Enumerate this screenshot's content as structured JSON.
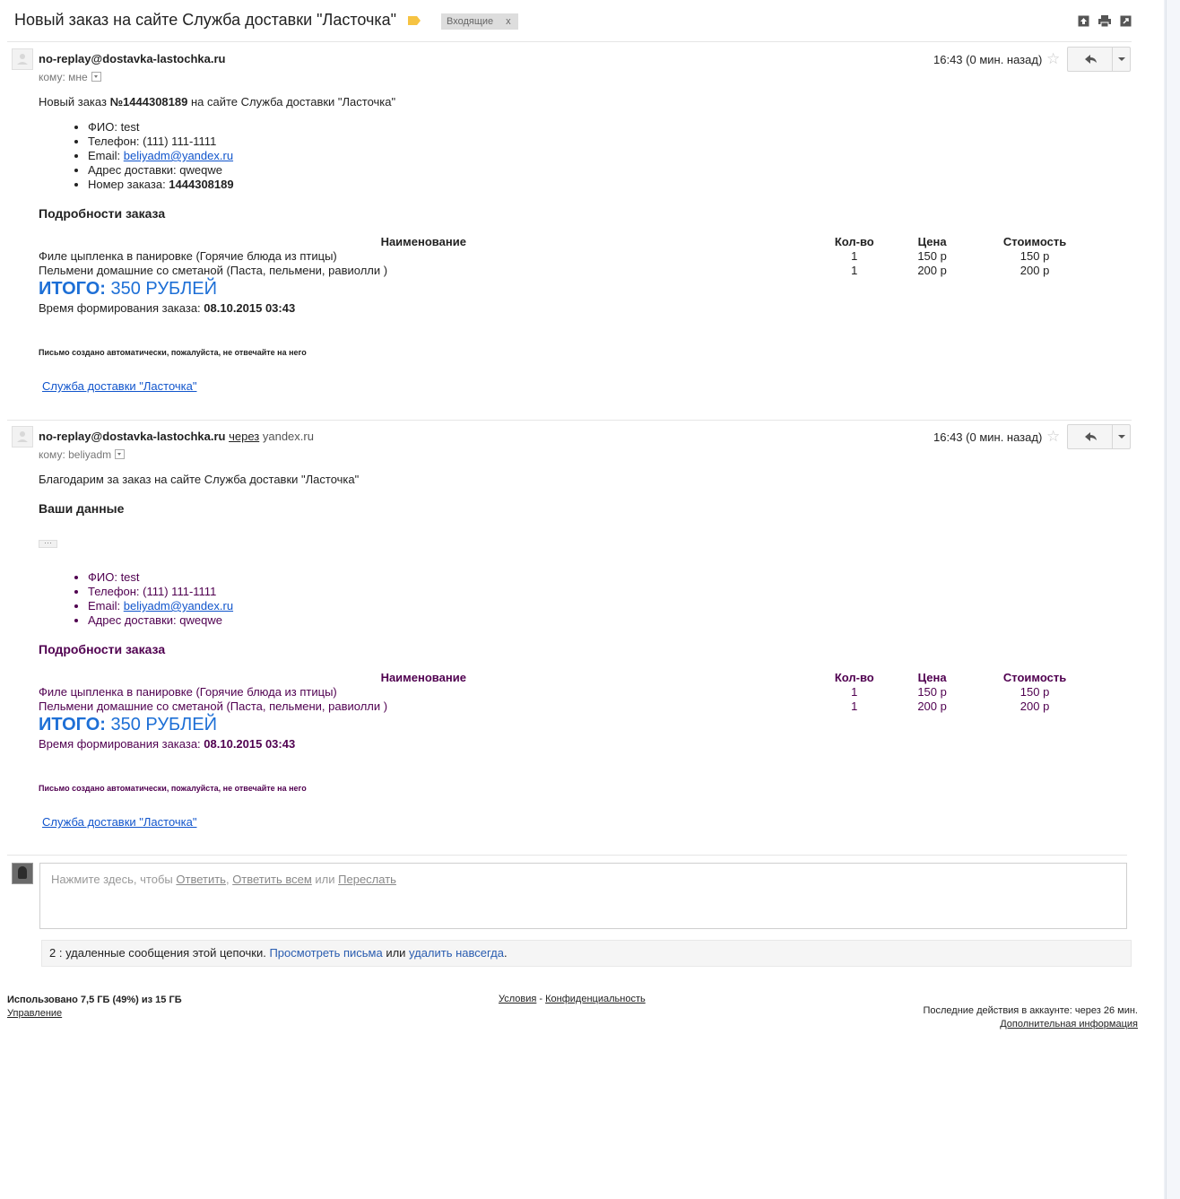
{
  "thread": {
    "subject": "Новый заказ на сайте Служба доставки \"Ласточка\"",
    "label": "Входящие",
    "label_close": "x",
    "label_color": "#f6c342",
    "top_icons": [
      "archive-icon",
      "print-icon",
      "new-window-icon"
    ]
  },
  "messages": [
    {
      "sender": "no-replay@dostavka-lastochka.ru",
      "to": "кому: мне",
      "time": "16:43 (0 мин. назад)",
      "intro_prefix": "Новый заказ ",
      "intro_number": "№1444308189",
      "intro_suffix": " на сайте Служба доставки \"Ласточка\"",
      "info": {
        "fio": "ФИО: test",
        "phone": "Телефон: (111) 111-1111",
        "email_label": "Email: ",
        "email": "beliyadm@yandex.ru",
        "address": "Адрес доставки: qweqwe",
        "order_label": "Номер заказа: ",
        "order_number": "1444308189"
      },
      "details_title": "Подробности заказа",
      "table": {
        "headers": [
          "Наименование",
          "Кол-во",
          "Цена",
          "Стоимость"
        ],
        "rows": [
          [
            "Филе цыпленка в панировке (Горячие блюда из птицы)",
            "1",
            "150 р",
            "150 р"
          ],
          [
            "Пельмени домашние со сметаной (Паста, пельмени, равиолли )",
            "1",
            "200 р",
            "200 р"
          ]
        ]
      },
      "total_label": "ИТОГО:",
      "total_value": " 350 РУБЛЕЙ",
      "time_label": "Время формирования заказа: ",
      "time_value": "08.10.2015 03:43",
      "auto_note": "Письмо создано автоматически, пожалуйста, не отвечайте на него",
      "company": "Служба доставки \"Ласточка\""
    },
    {
      "sender": "no-replay@dostavka-lastochka.ru",
      "via_word": "через",
      "via_domain": "yandex.ru",
      "to": "кому: beliyadm",
      "time": "16:43 (0 мин. назад)",
      "thanks": "Благодарим за заказ на сайте Служба доставки \"Ласточка\"",
      "your_data_title": "Ваши данные",
      "info": {
        "fio": "ФИО: test",
        "phone": "Телефон: (111) 111-1111",
        "email_label": "Email: ",
        "email": "beliyadm@yandex.ru",
        "address": "Адрес доставки: qweqwe"
      },
      "details_title": "Подробности заказа",
      "table": {
        "headers": [
          "Наименование",
          "Кол-во",
          "Цена",
          "Стоимость"
        ],
        "rows": [
          [
            "Филе цыпленка в панировке (Горячие блюда из птицы)",
            "1",
            "150 р",
            "150 р"
          ],
          [
            "Пельмени домашние со сметаной (Паста, пельмени, равиолли )",
            "1",
            "200 р",
            "200 р"
          ]
        ]
      },
      "total_label": "ИТОГО:",
      "total_value": " 350 РУБЛЕЙ",
      "time_label": "Время формирования заказа: ",
      "time_value": "08.10.2015 03:43",
      "auto_note": "Письмо создано автоматически, пожалуйста, не отвечайте на него",
      "company": "Служба доставки \"Ласточка\""
    }
  ],
  "reply": {
    "prompt": "Нажмите здесь, чтобы ",
    "reply": "Ответить",
    "sep1": ", ",
    "reply_all": "Ответить всем",
    "or": " или ",
    "forward": "Переслать"
  },
  "deleted": {
    "text": "2 : удаленные сообщения этой цепочки. ",
    "view": "Просмотреть письма",
    "or": " или ",
    "delete": "удалить навсегда",
    "end": "."
  },
  "footer": {
    "storage": "Использовано 7,5 ГБ (49%) из 15 ГБ",
    "manage": "Управление",
    "terms": "Условия",
    "dash": " - ",
    "privacy": "Конфиденциальность",
    "activity": "Последние действия в аккаунте: через 26 мин.",
    "details": "Дополнительная информация"
  }
}
